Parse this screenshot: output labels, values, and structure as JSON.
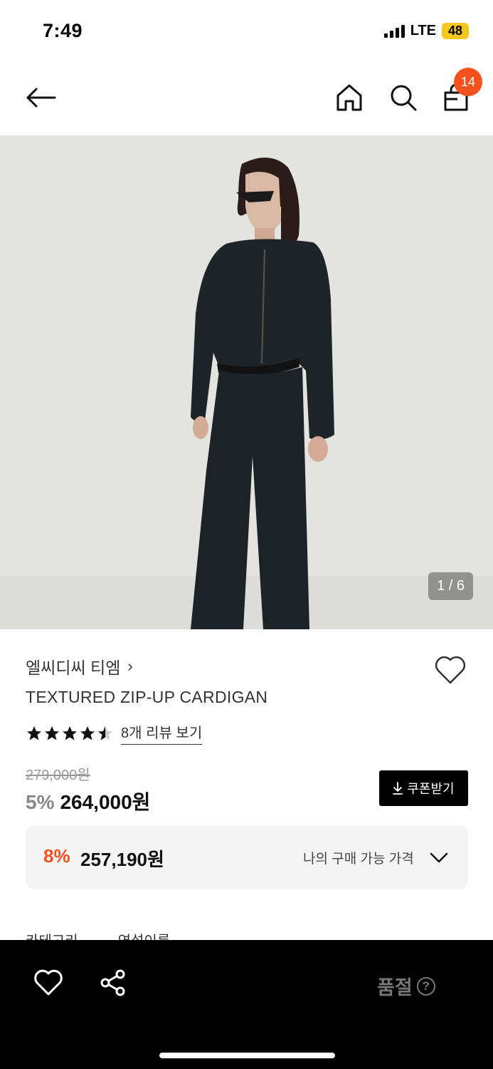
{
  "status_bar": {
    "time": "7:49",
    "network": "LTE",
    "battery": "48"
  },
  "nav": {
    "back_icon": "arrow-left-icon",
    "home_icon": "home-icon",
    "search_icon": "search-icon",
    "cart_icon": "shopping-bag-icon",
    "cart_count": "14"
  },
  "image": {
    "counter": "1 / 6"
  },
  "product": {
    "brand": "엘씨디씨 티엠",
    "brand_chevron": "›",
    "title": "TEXTURED ZIP-UP CARDIGAN",
    "rating": 4.5,
    "review_link": "8개 리뷰 보기",
    "original_price": "279,000원",
    "discount": "5%",
    "sale_price": "264,000원",
    "coupon_button": "쿠폰받기",
    "my_price": {
      "discount": "8%",
      "price": "257,190원",
      "label": "나의 구매 가능 가격"
    }
  },
  "tabs_peek": [
    "카테고리",
    "연설이름"
  ],
  "bottom_bar": {
    "soldout_label": "품절",
    "help_glyph": "?"
  },
  "colors": {
    "accent": "#f4511e",
    "bottom_bar": "#000000",
    "price_box": "#f4f4f4"
  }
}
